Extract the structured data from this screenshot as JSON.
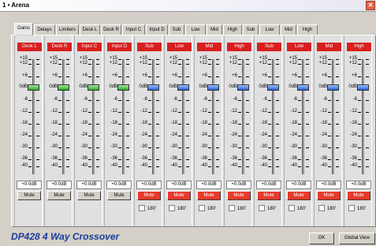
{
  "window": {
    "title": "1 • Arena"
  },
  "tabs": [
    {
      "label": "Gains",
      "active": true
    },
    {
      "label": "Delays"
    },
    {
      "label": "Limiters"
    },
    {
      "label": "Desk L"
    },
    {
      "label": "Desk R"
    },
    {
      "label": "Input C"
    },
    {
      "label": "Input D"
    },
    {
      "label": "Sub"
    },
    {
      "label": "Low"
    },
    {
      "label": "Mid"
    },
    {
      "label": "High"
    },
    {
      "label": "Sub"
    },
    {
      "label": "Low"
    },
    {
      "label": "Mid"
    },
    {
      "label": "High"
    }
  ],
  "scale": [
    "+15",
    "+12",
    "+6",
    "0dB",
    "-6",
    "-12",
    "-18",
    "-24",
    "-30",
    "-36",
    "-40"
  ],
  "channels": [
    {
      "name": "Desk L",
      "value": "+0.0dB",
      "mute": "Mute",
      "mute_active": false,
      "knob_color": "green",
      "gain_db": 0,
      "has_phase": false
    },
    {
      "name": "Desk R",
      "value": "+0.0dB",
      "mute": "Mute",
      "mute_active": false,
      "knob_color": "green",
      "gain_db": 0,
      "has_phase": false
    },
    {
      "name": "Input C",
      "value": "+0.0dB",
      "mute": "Mute",
      "mute_active": false,
      "knob_color": "green",
      "gain_db": 0,
      "has_phase": false
    },
    {
      "name": "Input D",
      "value": "+0.0dB",
      "mute": "Mute",
      "mute_active": false,
      "knob_color": "green",
      "gain_db": 0,
      "has_phase": false
    },
    {
      "name": "Sub",
      "value": "+0.0dB",
      "mute": "Mute",
      "mute_active": true,
      "knob_color": "blue",
      "gain_db": 0,
      "has_phase": true,
      "phase": "180'"
    },
    {
      "name": "Low",
      "value": "+0.0dB",
      "mute": "Mute",
      "mute_active": true,
      "knob_color": "blue",
      "gain_db": 0,
      "has_phase": true,
      "phase": "180'"
    },
    {
      "name": "Mid",
      "value": "+0.0dB",
      "mute": "Mute",
      "mute_active": true,
      "knob_color": "blue",
      "gain_db": 0,
      "has_phase": true,
      "phase": "180'"
    },
    {
      "name": "High",
      "value": "+0.0dB",
      "mute": "Mute",
      "mute_active": true,
      "knob_color": "blue",
      "gain_db": 0,
      "has_phase": true,
      "phase": "180'"
    },
    {
      "name": "Sub",
      "value": "+0.0dB",
      "mute": "Mute",
      "mute_active": true,
      "knob_color": "blue",
      "gain_db": 0,
      "has_phase": true,
      "phase": "180'"
    },
    {
      "name": "Low",
      "value": "+0.0dB",
      "mute": "Mute",
      "mute_active": true,
      "knob_color": "blue",
      "gain_db": 0,
      "has_phase": true,
      "phase": "180'"
    },
    {
      "name": "Mid",
      "value": "+0.0dB",
      "mute": "Mute",
      "mute_active": true,
      "knob_color": "blue",
      "gain_db": 0,
      "has_phase": true,
      "phase": "180'"
    },
    {
      "name": "High",
      "value": "+0.0dB",
      "mute": "Mute",
      "mute_active": true,
      "knob_color": "blue",
      "gain_db": 0,
      "has_phase": true,
      "phase": "180'"
    }
  ],
  "footer": {
    "title": "DP428 4 Way Crossover",
    "ok_label": "OK",
    "global_view_label": "Global View"
  },
  "colors": {
    "channel_label_bg": "#d81f1f",
    "mute_active_bg": "#e8392a",
    "footer_title": "#1a3b9c"
  }
}
